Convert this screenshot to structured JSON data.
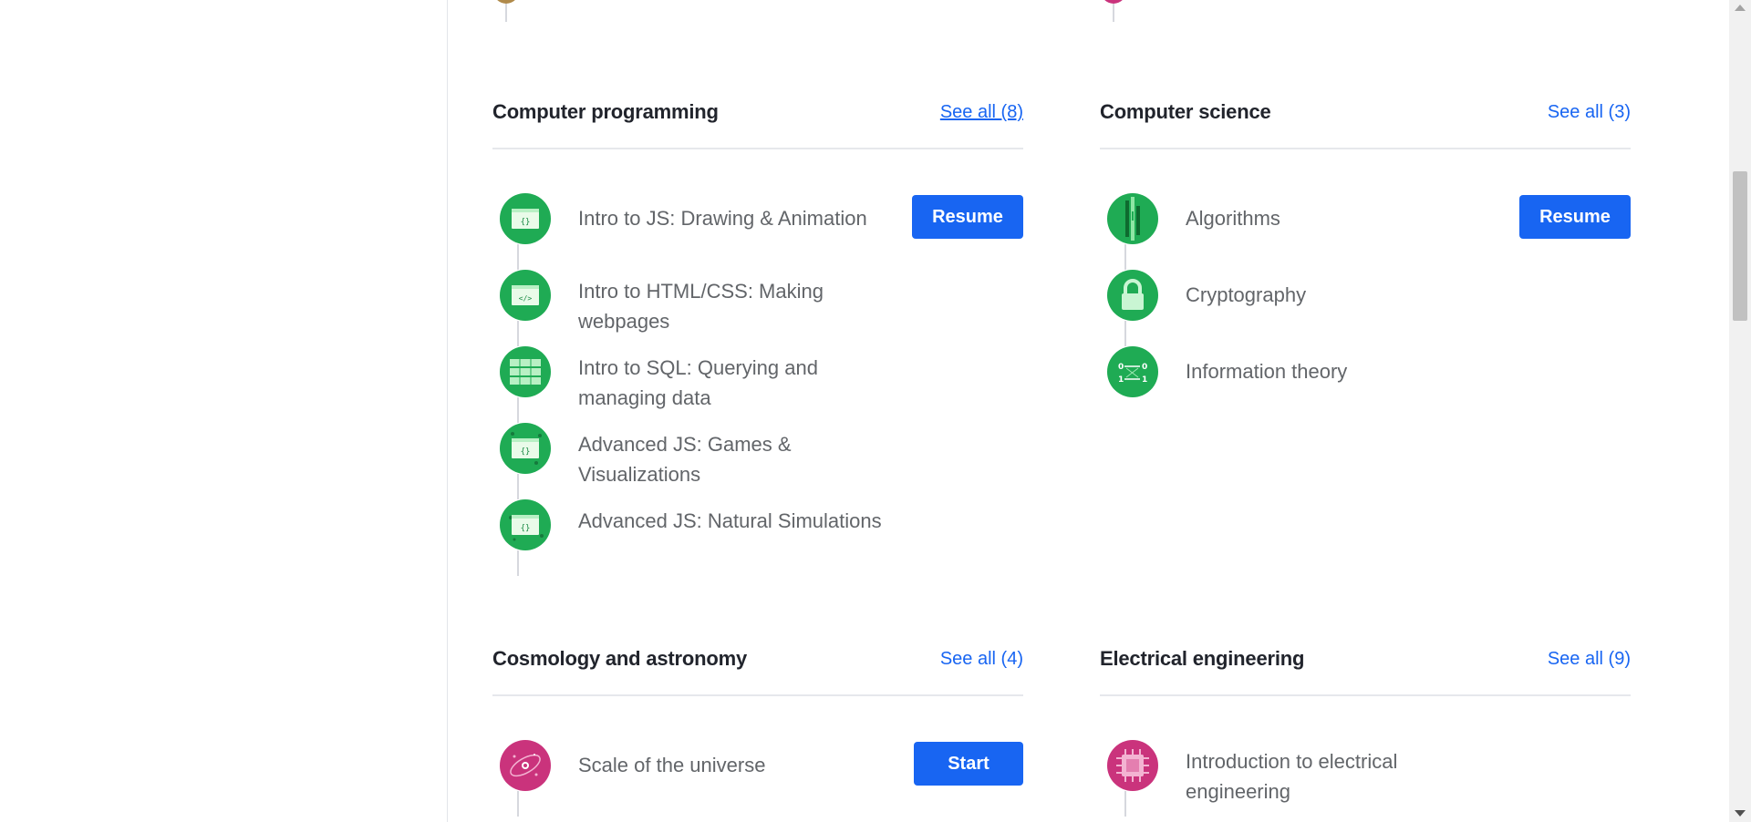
{
  "sections": [
    {
      "title": "Computer programming",
      "see_all": "See all (8)",
      "items": [
        {
          "label": "Intro to JS: Drawing & Animation",
          "icon": "js-drawing-icon"
        },
        {
          "label": "Intro to HTML/CSS: Making webpages",
          "icon": "html-css-icon"
        },
        {
          "label": "Intro to SQL: Querying and managing data",
          "icon": "sql-icon"
        },
        {
          "label": "Advanced JS: Games & Visualizations",
          "icon": "js-games-icon"
        },
        {
          "label": "Advanced JS: Natural Simulations",
          "icon": "js-simulations-icon"
        }
      ],
      "button": "Resume"
    },
    {
      "title": "Computer science",
      "see_all": "See all (3)",
      "items": [
        {
          "label": "Algorithms",
          "icon": "algorithms-icon"
        },
        {
          "label": "Cryptography",
          "icon": "lock-icon"
        },
        {
          "label": "Information theory",
          "icon": "information-theory-icon"
        }
      ],
      "button": "Resume"
    },
    {
      "title": "Cosmology and astronomy",
      "see_all": "See all (4)",
      "items": [
        {
          "label": "Scale of the universe",
          "icon": "galaxy-icon"
        }
      ],
      "button": "Start"
    },
    {
      "title": "Electrical engineering",
      "see_all": "See all (9)",
      "items": [
        {
          "label": "Introduction to electrical engineering",
          "icon": "microchip-icon"
        }
      ]
    }
  ],
  "colors": {
    "accent": "#1865f2",
    "programming_green": "#1fab54",
    "science_pink": "#ca337c",
    "text_muted": "#626569"
  }
}
